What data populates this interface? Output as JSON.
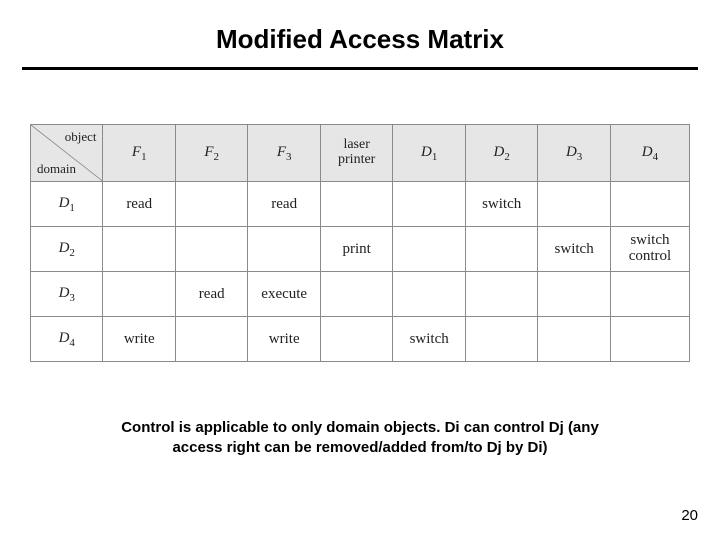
{
  "title": "Modified Access Matrix",
  "corner": {
    "object": "object",
    "domain": "domain"
  },
  "columns": [
    {
      "var": "F",
      "sub": "1"
    },
    {
      "var": "F",
      "sub": "2"
    },
    {
      "var": "F",
      "sub": "3"
    },
    {
      "plain1": "laser",
      "plain2": "printer"
    },
    {
      "var": "D",
      "sub": "1"
    },
    {
      "var": "D",
      "sub": "2"
    },
    {
      "var": "D",
      "sub": "3"
    },
    {
      "var": "D",
      "sub": "4"
    }
  ],
  "rows": [
    {
      "head": {
        "var": "D",
        "sub": "1"
      },
      "cells": [
        "read",
        "",
        "read",
        "",
        "",
        "switch",
        "",
        ""
      ]
    },
    {
      "head": {
        "var": "D",
        "sub": "2"
      },
      "cells": [
        "",
        "",
        "",
        "print",
        "",
        "",
        "switch",
        "switch\ncontrol"
      ]
    },
    {
      "head": {
        "var": "D",
        "sub": "3"
      },
      "cells": [
        "",
        "read",
        "execute",
        "",
        "",
        "",
        "",
        ""
      ]
    },
    {
      "head": {
        "var": "D",
        "sub": "4"
      },
      "cells": [
        "write",
        "",
        "write",
        "",
        "switch",
        "",
        "",
        ""
      ]
    }
  ],
  "caption": {
    "line1": "Control is applicable to only domain objects.  Di can control Dj (any",
    "line2": "access right can be removed/added from/to Dj by Di)"
  },
  "pagenum": "20",
  "chart_data": {
    "type": "table",
    "title": "Modified Access Matrix",
    "row_axis": "domain",
    "col_axis": "object",
    "columns": [
      "F1",
      "F2",
      "F3",
      "laser printer",
      "D1",
      "D2",
      "D3",
      "D4"
    ],
    "rows": [
      "D1",
      "D2",
      "D3",
      "D4"
    ],
    "cells": {
      "D1": {
        "F1": "read",
        "F3": "read",
        "D2": "switch"
      },
      "D2": {
        "laser printer": "print",
        "D3": "switch",
        "D4": "switch control"
      },
      "D3": {
        "F2": "read",
        "F3": "execute"
      },
      "D4": {
        "F1": "write",
        "F3": "write",
        "D1": "switch"
      }
    }
  }
}
